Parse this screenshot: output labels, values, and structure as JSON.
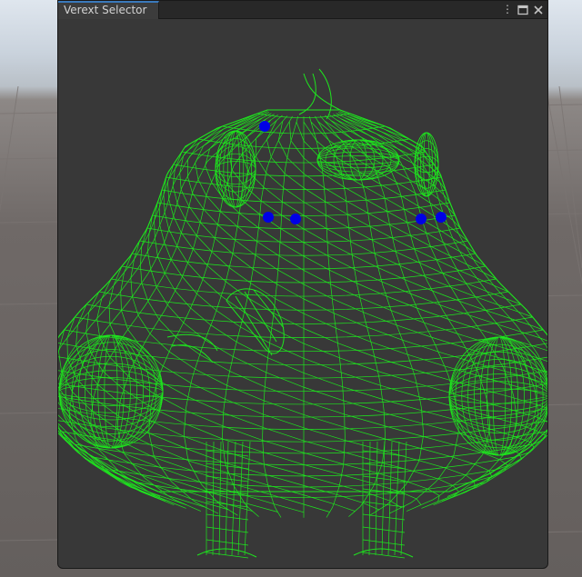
{
  "window": {
    "tab_title": "Verext Selector"
  },
  "controls": {
    "menu_icon": "kebab-menu-icon",
    "maximize_icon": "maximize-icon",
    "close_icon": "close-icon",
    "menu_glyph": "⋮",
    "maximize_glyph": "🗖",
    "close_glyph": "✕"
  },
  "scene": {
    "wire_color": "#1ee61e",
    "background_color": "#383838",
    "selected_vertex_color": "#0000e6",
    "selected_vertex_count": 5
  }
}
